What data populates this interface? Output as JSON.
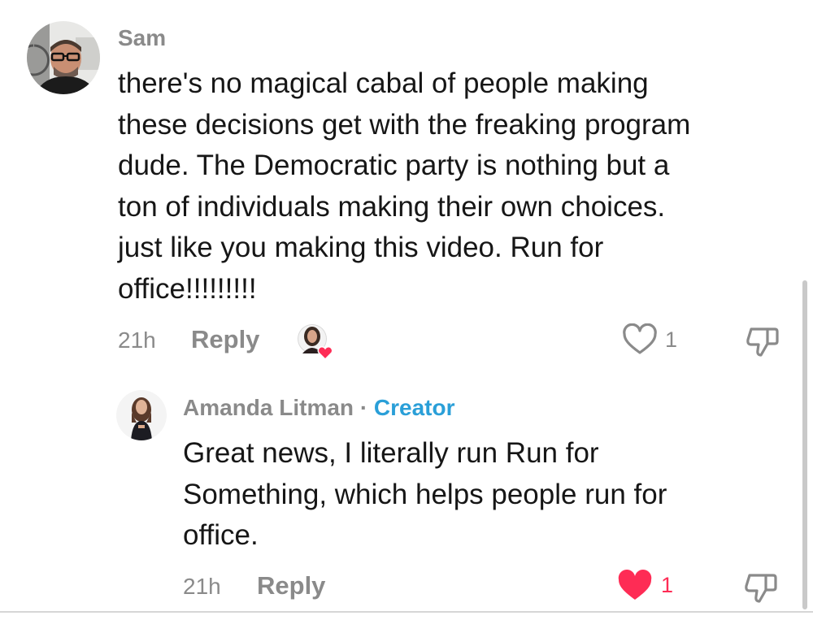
{
  "comment": {
    "username": "Sam",
    "text_lines": [
      "there's no magical cabal of people making",
      "these decisions get with the freaking program",
      "dude. The Democratic party is nothing but a",
      "ton of individuals making their own choices.",
      "just like you making this video. Run for",
      "office!!!!!!!!!"
    ],
    "time": "21h",
    "reply_label": "Reply",
    "like_count": "1",
    "liked_by_creator": true,
    "icons": [
      "avatar",
      "creator-liked-avatar",
      "heart-outline-icon",
      "thumbs-down-icon"
    ]
  },
  "reply": {
    "username": "Amanda Litman",
    "separator": "·",
    "badge": "Creator",
    "text_lines": [
      "Great news, I literally run Run for",
      "Something, which helps people run for",
      "office."
    ],
    "time": "21h",
    "reply_label": "Reply",
    "like_count": "1",
    "liked": true,
    "icons": [
      "avatar",
      "heart-filled-icon",
      "thumbs-down-icon"
    ]
  },
  "colors": {
    "text": "#161616",
    "muted": "#8a8a8a",
    "creator": "#2a9fd8",
    "heart": "#fe2c55"
  }
}
